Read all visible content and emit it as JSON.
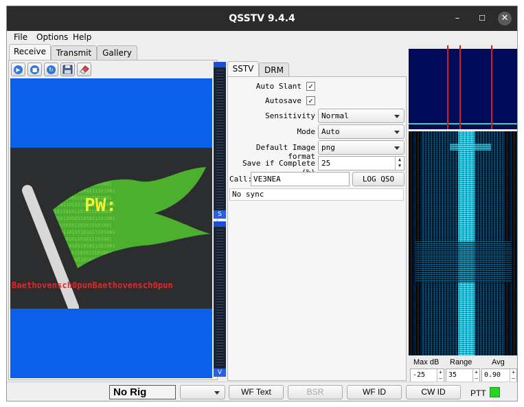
{
  "window": {
    "title": "QSSTV 9.4.4",
    "minimize": "–",
    "maximize": "☐",
    "close": "✕"
  },
  "menu": {
    "file": "File",
    "options": "Options",
    "help": "Help"
  },
  "main_tabs": {
    "receive": "Receive",
    "transmit": "Transmit",
    "gallery": "Gallery"
  },
  "toolbar": [
    "play-icon",
    "stop-icon",
    "refresh-icon",
    "save-icon",
    "eraser-icon"
  ],
  "image": {
    "overlay_text": "PW:",
    "footer_text": "Baethovensch0punBaethovensch0pun",
    "binary_text": "1010110101101011101001"
  },
  "slider_labels": {
    "sync": "S",
    "volume": "V"
  },
  "mode_tabs": {
    "sstv": "SSTV",
    "drm": "DRM"
  },
  "settings": {
    "auto_slant_label": "Auto Slant",
    "auto_slant_checked": "✓",
    "autosave_label": "Autosave",
    "autosave_checked": "✓",
    "sensitivity_label": "Sensitivity",
    "sensitivity_value": "Normal",
    "mode_label": "Mode",
    "mode_value": "Auto",
    "format_label": "Default Image format",
    "format_value": "png",
    "save_label": "Save if Complete (%)",
    "save_value": "25",
    "call_label": "Call:",
    "call_value": "VE3NEA",
    "log_qso": "LOG QSO",
    "sync_status": "No sync"
  },
  "waterfall": {
    "max_db_label": "Max  dB",
    "range_label": "Range",
    "avg_label": "Avg",
    "max_db_value": "-25",
    "range_value": "35",
    "avg_value": "0.90",
    "plus": "+",
    "minus": "–"
  },
  "status": {
    "rig": "No Rig",
    "wf_text": "WF Text",
    "bsr": "BSR",
    "wf_id": "WF ID",
    "cw_id": "CW ID",
    "ptt": "PTT",
    "ptt_color": "#1fd81f"
  }
}
